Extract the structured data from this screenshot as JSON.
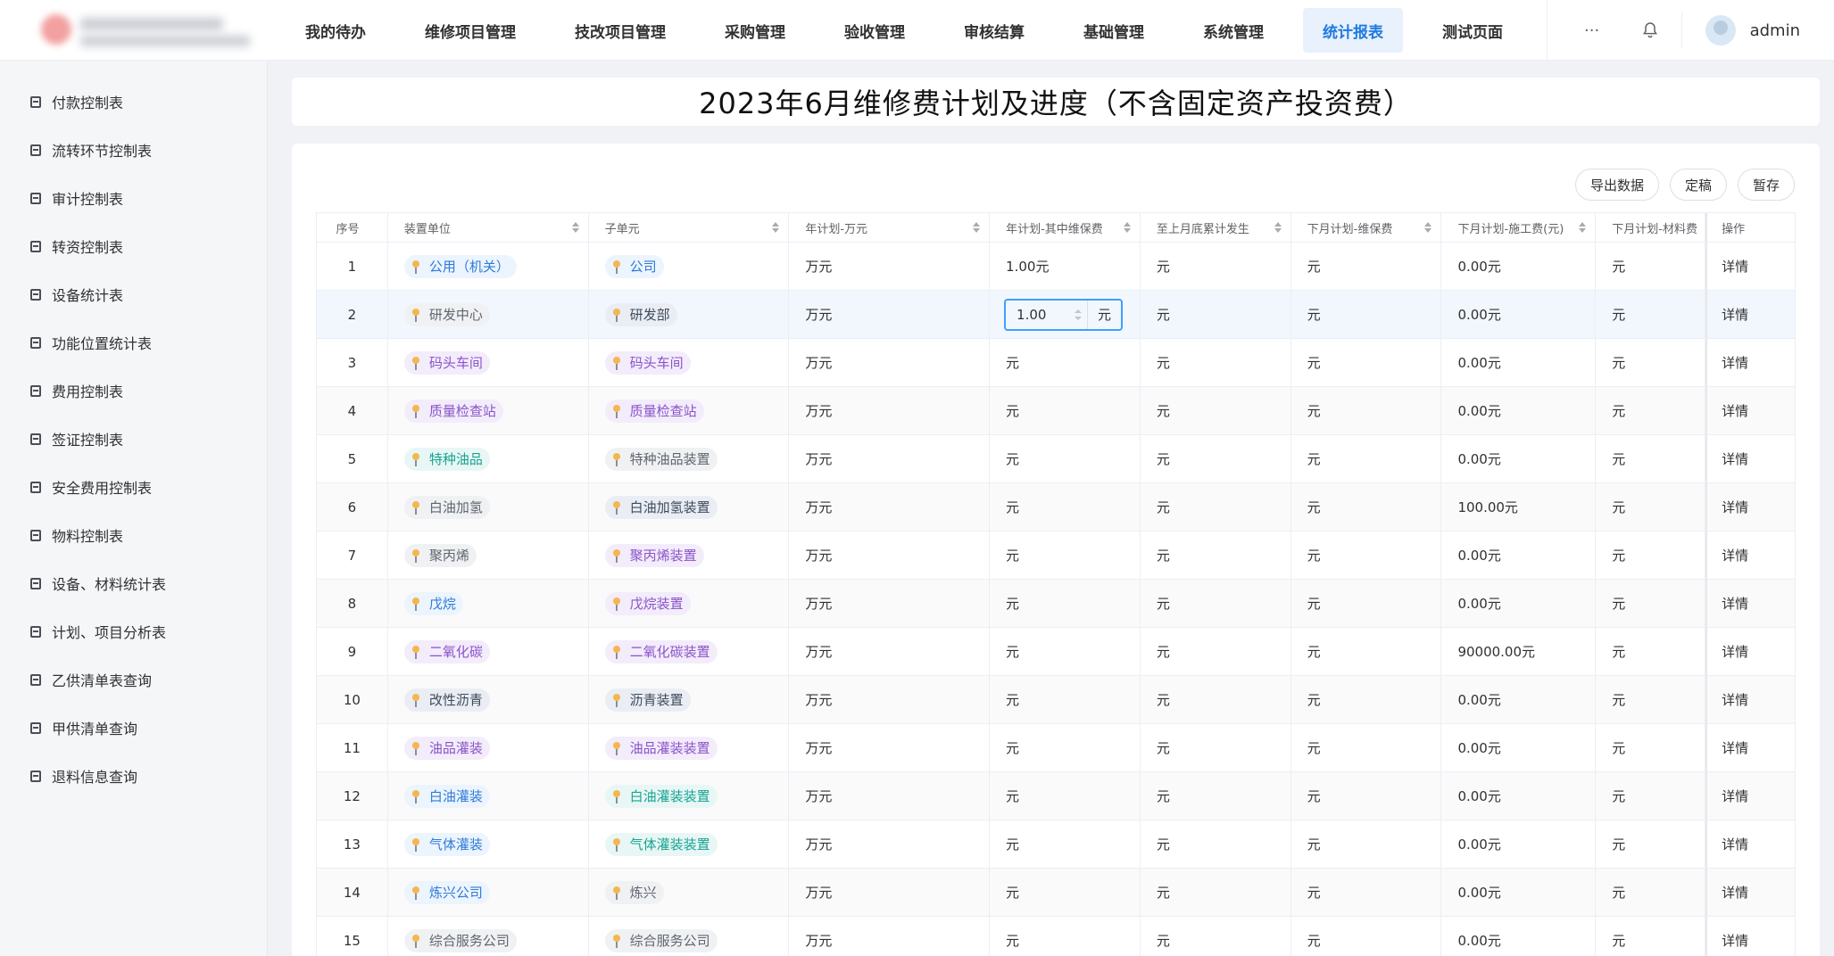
{
  "header": {
    "nav": [
      {
        "label": "我的待办",
        "active": false
      },
      {
        "label": "维修项目管理",
        "active": false
      },
      {
        "label": "技改项目管理",
        "active": false
      },
      {
        "label": "采购管理",
        "active": false
      },
      {
        "label": "验收管理",
        "active": false
      },
      {
        "label": "审核结算",
        "active": false
      },
      {
        "label": "基础管理",
        "active": false
      },
      {
        "label": "系统管理",
        "active": false
      },
      {
        "label": "统计报表",
        "active": true
      },
      {
        "label": "测试页面",
        "active": false
      }
    ],
    "more_label": "···",
    "username": "admin"
  },
  "sidebar": {
    "items": [
      {
        "label": "付款控制表"
      },
      {
        "label": "流转环节控制表"
      },
      {
        "label": "审计控制表"
      },
      {
        "label": "转资控制表"
      },
      {
        "label": "设备统计表"
      },
      {
        "label": "功能位置统计表"
      },
      {
        "label": "费用控制表"
      },
      {
        "label": "签证控制表"
      },
      {
        "label": "安全费用控制表"
      },
      {
        "label": "物料控制表"
      },
      {
        "label": "设备、材料统计表"
      },
      {
        "label": "计划、项目分析表"
      },
      {
        "label": "乙供清单表查询"
      },
      {
        "label": "甲供清单查询"
      },
      {
        "label": "退料信息查询"
      }
    ]
  },
  "page": {
    "title": "2023年6月维修费计划及进度（不含固定资产投资费）"
  },
  "actions": {
    "export_label": "导出数据",
    "finalize_label": "定稿",
    "save_label": "暂存"
  },
  "table": {
    "headers": [
      "序号",
      "装置单位",
      "子单元",
      "年计划-万元",
      "年计划-其中维保费",
      "至上月底累计发生",
      "下月计划-维保费",
      "下月计划-施工费(元)",
      "下月计划-材料费",
      "操作"
    ],
    "editing": {
      "value": "1.00",
      "unit": "元"
    },
    "rows": [
      {
        "no": "1",
        "unit": "公用（机关）",
        "unit_color": "blue",
        "sub": "公司",
        "sub_color": "blue",
        "year": "万元",
        "maint": "1.00元",
        "cum": "元",
        "next_maint": "元",
        "next_cons": "0.00元",
        "next_mat": "元",
        "op": "详情"
      },
      {
        "no": "2",
        "unit": "研发中心",
        "unit_color": "gray",
        "sub": "研发部",
        "sub_color": "slate",
        "year": "万元",
        "maint": "",
        "cum": "元",
        "next_maint": "元",
        "next_cons": "0.00元",
        "next_mat": "元",
        "op": "详情",
        "editing": true
      },
      {
        "no": "3",
        "unit": "码头车间",
        "unit_color": "purple",
        "sub": "码头车间",
        "sub_color": "purple",
        "year": "万元",
        "maint": "元",
        "cum": "元",
        "next_maint": "元",
        "next_cons": "0.00元",
        "next_mat": "元",
        "op": "详情"
      },
      {
        "no": "4",
        "unit": "质量检查站",
        "unit_color": "purple",
        "sub": "质量检查站",
        "sub_color": "purple",
        "year": "万元",
        "maint": "元",
        "cum": "元",
        "next_maint": "元",
        "next_cons": "0.00元",
        "next_mat": "元",
        "op": "详情"
      },
      {
        "no": "5",
        "unit": "特种油品",
        "unit_color": "teal",
        "sub": "特种油品装置",
        "sub_color": "gray",
        "year": "万元",
        "maint": "元",
        "cum": "元",
        "next_maint": "元",
        "next_cons": "0.00元",
        "next_mat": "元",
        "op": "详情"
      },
      {
        "no": "6",
        "unit": "白油加氢",
        "unit_color": "gray",
        "sub": "白油加氢装置",
        "sub_color": "slate",
        "year": "万元",
        "maint": "元",
        "cum": "元",
        "next_maint": "元",
        "next_cons": "100.00元",
        "next_mat": "元",
        "op": "详情"
      },
      {
        "no": "7",
        "unit": "聚丙烯",
        "unit_color": "gray",
        "sub": "聚丙烯装置",
        "sub_color": "purple",
        "year": "万元",
        "maint": "元",
        "cum": "元",
        "next_maint": "元",
        "next_cons": "0.00元",
        "next_mat": "元",
        "op": "详情"
      },
      {
        "no": "8",
        "unit": "戊烷",
        "unit_color": "blue",
        "sub": "戊烷装置",
        "sub_color": "purple",
        "year": "万元",
        "maint": "元",
        "cum": "元",
        "next_maint": "元",
        "next_cons": "0.00元",
        "next_mat": "元",
        "op": "详情"
      },
      {
        "no": "9",
        "unit": "二氧化碳",
        "unit_color": "purple",
        "sub": "二氧化碳装置",
        "sub_color": "purple",
        "year": "万元",
        "maint": "元",
        "cum": "元",
        "next_maint": "元",
        "next_cons": "90000.00元",
        "next_mat": "元",
        "op": "详情"
      },
      {
        "no": "10",
        "unit": "改性沥青",
        "unit_color": "slate",
        "sub": "沥青装置",
        "sub_color": "slate",
        "year": "万元",
        "maint": "元",
        "cum": "元",
        "next_maint": "元",
        "next_cons": "0.00元",
        "next_mat": "元",
        "op": "详情"
      },
      {
        "no": "11",
        "unit": "油品灌装",
        "unit_color": "purple",
        "sub": "油品灌装装置",
        "sub_color": "purple",
        "year": "万元",
        "maint": "元",
        "cum": "元",
        "next_maint": "元",
        "next_cons": "0.00元",
        "next_mat": "元",
        "op": "详情"
      },
      {
        "no": "12",
        "unit": "白油灌装",
        "unit_color": "blue",
        "sub": "白油灌装装置",
        "sub_color": "teal",
        "year": "万元",
        "maint": "元",
        "cum": "元",
        "next_maint": "元",
        "next_cons": "0.00元",
        "next_mat": "元",
        "op": "详情"
      },
      {
        "no": "13",
        "unit": "气体灌装",
        "unit_color": "blue",
        "sub": "气体灌装装置",
        "sub_color": "teal",
        "year": "万元",
        "maint": "元",
        "cum": "元",
        "next_maint": "元",
        "next_cons": "0.00元",
        "next_mat": "元",
        "op": "详情"
      },
      {
        "no": "14",
        "unit": "炼兴公司",
        "unit_color": "blue",
        "sub": "炼兴",
        "sub_color": "gray",
        "year": "万元",
        "maint": "元",
        "cum": "元",
        "next_maint": "元",
        "next_cons": "0.00元",
        "next_mat": "元",
        "op": "详情"
      },
      {
        "no": "15",
        "unit": "综合服务公司",
        "unit_color": "gray",
        "sub": "综合服务公司",
        "sub_color": "gray",
        "year": "万元",
        "maint": "元",
        "cum": "元",
        "next_maint": "元",
        "next_cons": "0.00元",
        "next_mat": "元",
        "op": "详情"
      }
    ]
  }
}
